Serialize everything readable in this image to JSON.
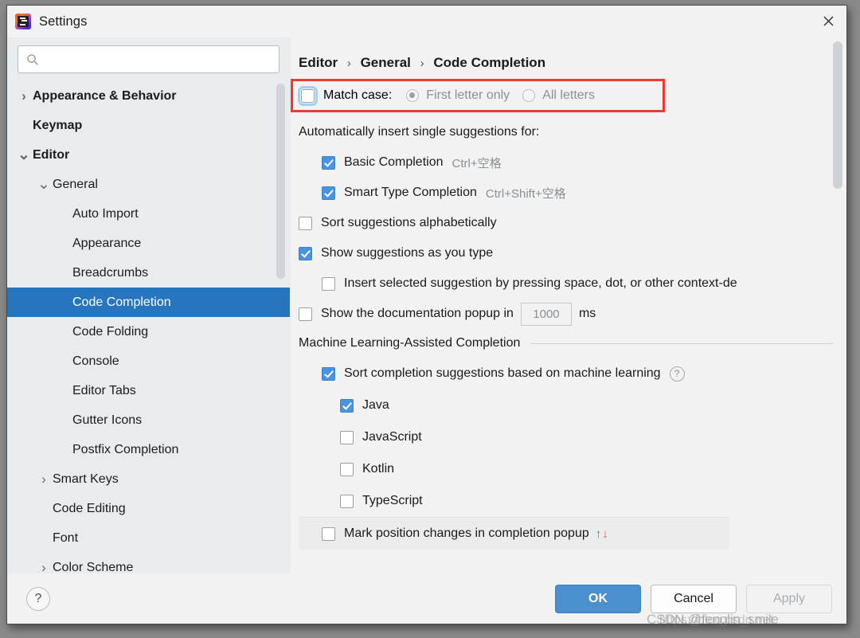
{
  "window": {
    "title": "Settings",
    "app_icon": "intellij-idea-icon",
    "close_icon": "close-icon"
  },
  "search": {
    "placeholder": "",
    "value": "",
    "icon": "search-icon"
  },
  "sidebar": {
    "items": [
      {
        "label": "Appearance & Behavior",
        "indent": 0,
        "twisty": "›",
        "bold": true,
        "selected": false
      },
      {
        "label": "Keymap",
        "indent": 0,
        "twisty": "",
        "bold": true,
        "selected": false
      },
      {
        "label": "Editor",
        "indent": 0,
        "twisty": "⌄",
        "bold": true,
        "selected": false
      },
      {
        "label": "General",
        "indent": 1,
        "twisty": "⌄",
        "bold": false,
        "selected": false
      },
      {
        "label": "Auto Import",
        "indent": 2,
        "twisty": "",
        "bold": false,
        "selected": false
      },
      {
        "label": "Appearance",
        "indent": 2,
        "twisty": "",
        "bold": false,
        "selected": false
      },
      {
        "label": "Breadcrumbs",
        "indent": 2,
        "twisty": "",
        "bold": false,
        "selected": false
      },
      {
        "label": "Code Completion",
        "indent": 2,
        "twisty": "",
        "bold": false,
        "selected": true
      },
      {
        "label": "Code Folding",
        "indent": 2,
        "twisty": "",
        "bold": false,
        "selected": false
      },
      {
        "label": "Console",
        "indent": 2,
        "twisty": "",
        "bold": false,
        "selected": false
      },
      {
        "label": "Editor Tabs",
        "indent": 2,
        "twisty": "",
        "bold": false,
        "selected": false
      },
      {
        "label": "Gutter Icons",
        "indent": 2,
        "twisty": "",
        "bold": false,
        "selected": false
      },
      {
        "label": "Postfix Completion",
        "indent": 2,
        "twisty": "",
        "bold": false,
        "selected": false
      },
      {
        "label": "Smart Keys",
        "indent": 1,
        "twisty": "›",
        "bold": false,
        "selected": false
      },
      {
        "label": "Code Editing",
        "indent": 1,
        "twisty": "",
        "bold": false,
        "selected": false
      },
      {
        "label": "Font",
        "indent": 1,
        "twisty": "",
        "bold": false,
        "selected": false
      },
      {
        "label": "Color Scheme",
        "indent": 1,
        "twisty": "›",
        "bold": false,
        "selected": false
      }
    ]
  },
  "breadcrumb": {
    "part1": "Editor",
    "sep1": "›",
    "part2": "General",
    "sep2": "›",
    "part3": "Code Completion"
  },
  "main": {
    "match_case": {
      "label": "Match case:",
      "checked": false,
      "focused": true,
      "highlight_color": "#f0392b",
      "options": [
        {
          "label": "First letter only",
          "selected": true,
          "disabled": true
        },
        {
          "label": "All letters",
          "selected": false,
          "disabled": true
        }
      ]
    },
    "auto_insert_label": "Automatically insert single suggestions for:",
    "auto_insert_items": [
      {
        "label": "Basic Completion",
        "shortcut": "Ctrl+空格",
        "checked": true
      },
      {
        "label": "Smart Type Completion",
        "shortcut": "Ctrl+Shift+空格",
        "checked": true
      }
    ],
    "sort_alphabetically": {
      "label": "Sort suggestions alphabetically",
      "checked": false
    },
    "show_as_you_type": {
      "label": "Show suggestions as you type",
      "checked": true
    },
    "insert_on_space": {
      "label": "Insert selected suggestion by pressing space, dot, or other context-de",
      "checked": false
    },
    "doc_popup": {
      "label": "Show the documentation popup in",
      "checked": false,
      "delay_value": "1000",
      "unit": "ms"
    },
    "ml_section": {
      "title": "Machine Learning-Assisted Completion",
      "sort_by_ml": {
        "label": "Sort completion suggestions based on machine learning",
        "checked": true,
        "help_icon": "help-circle-icon",
        "help_glyph": "?"
      },
      "languages": [
        {
          "label": "Java",
          "checked": true
        },
        {
          "label": "JavaScript",
          "checked": false
        },
        {
          "label": "Kotlin",
          "checked": false
        },
        {
          "label": "TypeScript",
          "checked": false
        }
      ]
    },
    "mark_position": {
      "label": "Mark position changes in completion popup",
      "checked": false,
      "up_arrow": "↑",
      "down_arrow": "↓",
      "up_color": "#2e9e4f",
      "down_color": "#e05a4e"
    }
  },
  "footer": {
    "help_label": "?",
    "ok_label": "OK",
    "cancel_label": "Cancel",
    "apply_label": "Apply",
    "apply_disabled": true,
    "accent_color": "#4a8fce"
  },
  "watermark": {
    "text": "https://blog.csdn.net",
    "overlay": "CSDN.@fenglin_smile"
  }
}
